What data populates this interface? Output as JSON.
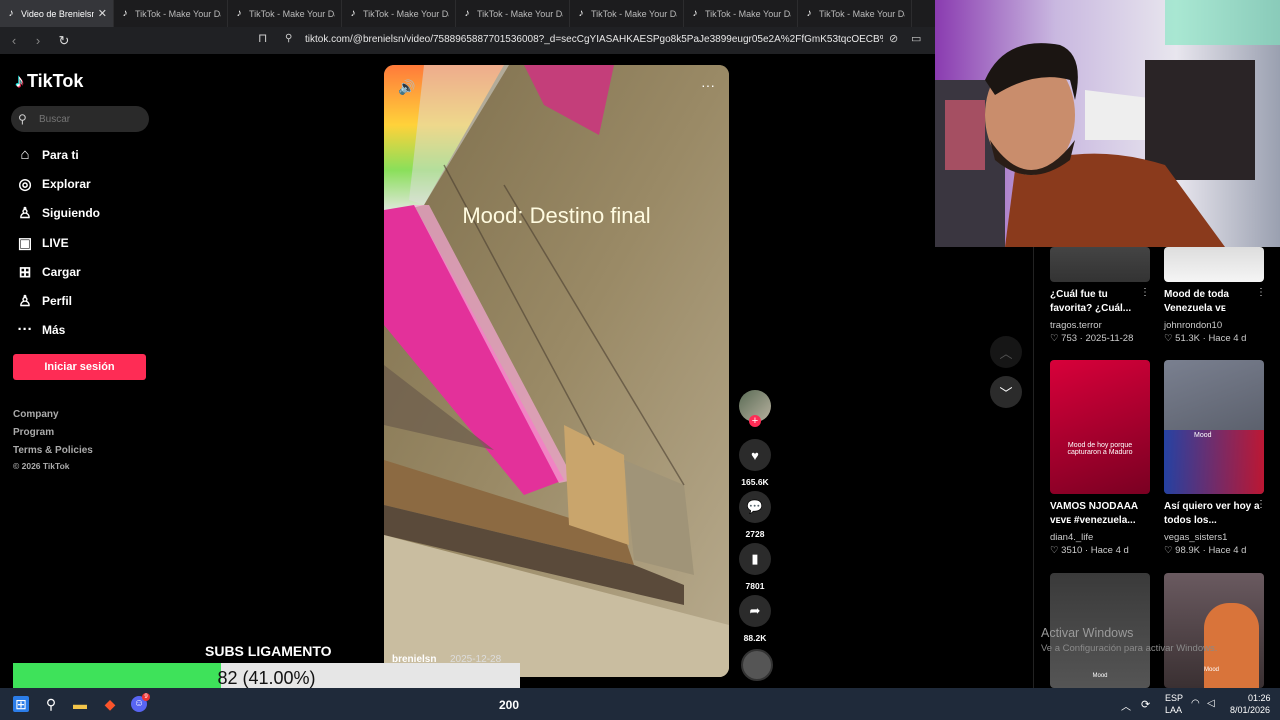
{
  "browser": {
    "tabs": [
      {
        "label": "Video de Brenielsn",
        "active": true
      },
      {
        "label": "TikTok - Make Your Day",
        "active": false
      },
      {
        "label": "TikTok - Make Your Day",
        "active": false
      },
      {
        "label": "TikTok - Make Your Day",
        "active": false
      },
      {
        "label": "TikTok - Make Your Day",
        "active": false
      },
      {
        "label": "TikTok - Make Your Day",
        "active": false
      },
      {
        "label": "TikTok - Make Your Day",
        "active": false
      },
      {
        "label": "TikTok - Make Your Day",
        "active": false
      }
    ],
    "url": "tiktok.com/@brenielsn/video/7588965887701536008?_d=secCgYIASAHKAESPgo8k5PaJe3899eugr05e2A%2FfGmK53tqcOECB%2FmeDR9U..."
  },
  "sidebar": {
    "logo": "TikTok",
    "search_placeholder": "Buscar",
    "nav": [
      {
        "label": "Para ti",
        "icon": "home-icon"
      },
      {
        "label": "Explorar",
        "icon": "compass-icon"
      },
      {
        "label": "Siguiendo",
        "icon": "following-icon"
      },
      {
        "label": "LIVE",
        "icon": "live-icon"
      },
      {
        "label": "Cargar",
        "icon": "upload-icon"
      },
      {
        "label": "Perfil",
        "icon": "profile-icon"
      },
      {
        "label": "Más",
        "icon": "more-icon"
      }
    ],
    "login_label": "Iniciar sesión",
    "footer": [
      "Company",
      "Program",
      "Terms & Policies"
    ],
    "copyright": "© 2026 TikTok"
  },
  "video": {
    "caption": "Mood: Destino final",
    "author": "brenielsn",
    "date": "2025-12-28"
  },
  "actions": {
    "likes": "165.6K",
    "comments": "2728",
    "saves": "7801",
    "shares": "88.2K"
  },
  "recommended": [
    {
      "title": "¿Cuál fue tu favorita? ¿Cuál...",
      "user": "tragos.terror",
      "likes": "753",
      "date": "2025-11-28"
    },
    {
      "title": "Mood de toda Venezuela ᴠᴇ",
      "user": "johnrondon10",
      "likes": "51.3K",
      "date": "Hace 4 d"
    },
    {
      "title": "VAMOS NJODAAA ᴠᴇᴠᴇ #venezuela...",
      "user": "dian4._life",
      "likes": "3510",
      "date": "Hace 4 d",
      "thumb_text": "Mood de hoy porque capturaron a Maduro"
    },
    {
      "title": "Así quiero ver hoy a todos los...",
      "user": "vegas_sisters1",
      "likes": "98.9K",
      "date": "Hace 4 d",
      "thumb_text": "Mood"
    },
    {
      "title": "",
      "user": "",
      "likes": "",
      "date": "",
      "thumb_text": "Mood"
    },
    {
      "title": "",
      "user": "",
      "likes": "",
      "date": "",
      "thumb_text": "Mood"
    }
  ],
  "windows": {
    "activate_title": "Activar Windows",
    "activate_sub": "Ve a Configuración para activar Windows."
  },
  "subs": {
    "title": "SUBS LIGAMENTO",
    "progress_text": "82 (41.00%)",
    "progress_fraction": 0.41
  },
  "taskbar": {
    "counter": "200",
    "lang_top": "ESP",
    "lang_bottom": "LAA",
    "time": "01:26",
    "date": "8/01/2026",
    "chat_badge": "9"
  }
}
